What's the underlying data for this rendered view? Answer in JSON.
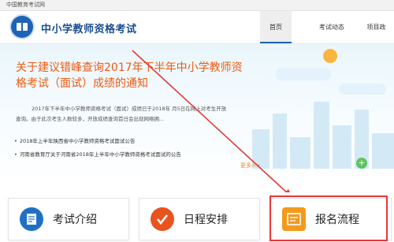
{
  "topbar": {
    "text": "中国教育考试网"
  },
  "header": {
    "title": "中小学教师资格考试",
    "nav": [
      {
        "label": "首页",
        "active": true
      },
      {
        "label": "考试动态",
        "active": false
      },
      {
        "label": "项目政",
        "active": false
      }
    ]
  },
  "banner": {
    "title": "关于建议错峰查询2017年下半年中小学教师资格考试（面试）成绩的通知",
    "text": "2017年下半年中小学教师资格考试（面试）成绩已于2018年 月5日在网上对考生开放查询。由于此次考生人数较多，开放成绩查询首日会出现网络拥...",
    "news": [
      "2018年上半年陕西省中小学教师资格考试面试公告",
      "河南省教育厅关于河南省2018年上半年中小学教师资格考试面试的公告"
    ],
    "more": "更多>>"
  },
  "cards": [
    {
      "label": "考试介绍",
      "icon": "exam-intro-icon",
      "color": "#1f6fc4"
    },
    {
      "label": "日程安排",
      "icon": "schedule-check-icon",
      "color": "#e8531e"
    },
    {
      "label": "报名流程",
      "icon": "registration-flow-icon",
      "color": "#f39a1d"
    }
  ],
  "colors": {
    "accent": "#1d63b6",
    "title": "#f05a0f",
    "highlight": "#e53935"
  }
}
